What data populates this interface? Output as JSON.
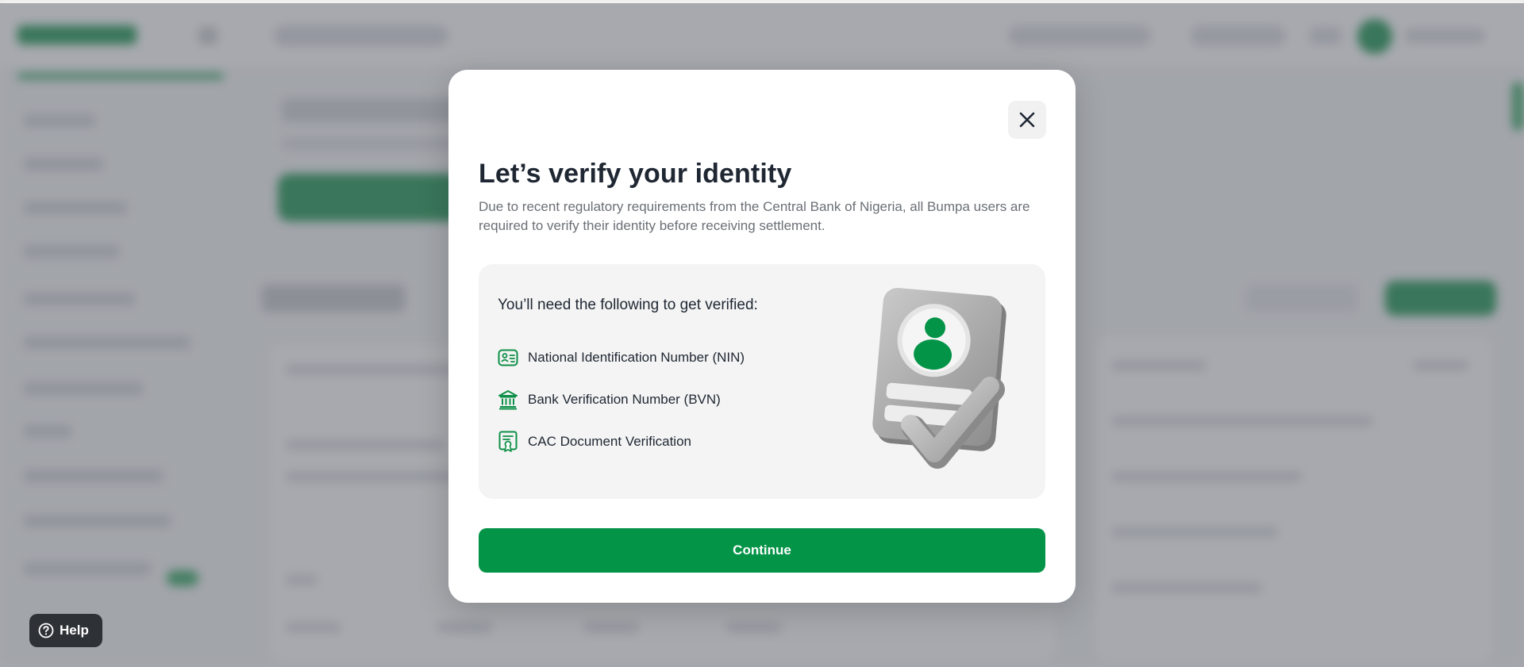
{
  "modal": {
    "title": "Let’s verify your identity",
    "description": "Due to recent regulatory requirements from the Central Bank of Nigeria, all Bumpa users are required to verify their identity before receiving settlement.",
    "close_icon": "close-icon",
    "requirements": {
      "heading": "You’ll need the following to get verified:",
      "items": [
        {
          "label": "National Identification Number (NIN)",
          "icon": "id-card-icon"
        },
        {
          "label": "Bank Verification Number (BVN)",
          "icon": "bank-icon"
        },
        {
          "label": "CAC Document Verification",
          "icon": "certificate-icon"
        }
      ],
      "illustration": "verified-id-illustration"
    },
    "continue_label": "Continue"
  },
  "help": {
    "label": "Help",
    "icon": "question-circle-icon"
  },
  "colors": {
    "primary_green": "#039447",
    "icon_green": "#0d8f47",
    "title_text": "#1f2733",
    "body_text": "#6b6f75",
    "card_background": "#f4f4f4",
    "overlay": "#5f636b",
    "help_background": "#2e3136"
  }
}
